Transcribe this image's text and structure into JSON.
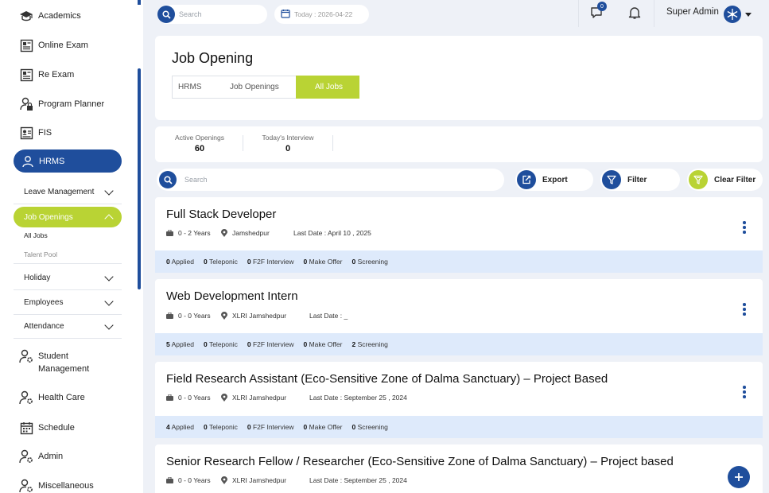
{
  "sidebar": {
    "items": [
      {
        "label": "Academics",
        "icon": "graduation-cap-icon"
      },
      {
        "label": "Online Exam",
        "icon": "exam-sheet-icon"
      },
      {
        "label": "Re Exam",
        "icon": "exam-sheet-icon"
      },
      {
        "label": "Program Planner",
        "icon": "user-lock-icon"
      },
      {
        "label": "FIS",
        "icon": "id-card-icon"
      },
      {
        "label": "HRMS",
        "icon": "user-icon"
      },
      {
        "label": "Student Management",
        "icon": "user-gear-icon"
      },
      {
        "label": "Health Care",
        "icon": "user-gear-icon"
      },
      {
        "label": "Schedule",
        "icon": "calendar-icon"
      },
      {
        "label": "Admin",
        "icon": "user-gear-icon"
      },
      {
        "label": "Miscellaneous",
        "icon": "user-gear-icon"
      }
    ],
    "hrms_sub": {
      "leave": "Leave Management",
      "job_openings": "Job Openings",
      "all_jobs": "All Jobs",
      "talent_pool": "Talent Pool",
      "holiday": "Holiday",
      "employees": "Employees",
      "attendance": "Attendance"
    }
  },
  "topbar": {
    "search_placeholder": "Search",
    "date": "Today : 2026-04-22",
    "message_count": "0",
    "user_name": "Super Admin"
  },
  "page": {
    "title": "Job Opening",
    "breadcrumb": [
      "HRMS",
      "Job Openings",
      "All Jobs"
    ]
  },
  "stats": {
    "active_label": "Active Openings",
    "active_value": "60",
    "interview_label": "Today's Interview",
    "interview_value": "0"
  },
  "toolbar": {
    "search_placeholder": "Search",
    "export": "Export",
    "filter": "Filter",
    "clear_filter": "Clear Filter"
  },
  "jobs": [
    {
      "title": "Full Stack Developer",
      "experience": "0 - 2 Years",
      "location": "Jamshedpur",
      "last_date": "Last Date : April 10 , 2025",
      "applied": "0",
      "telephonic": "0",
      "f2f": "0",
      "make_offer": "0",
      "screening": "0"
    },
    {
      "title": "Web Development Intern",
      "experience": "0 - 0 Years",
      "location": "XLRI Jamshedpur",
      "last_date": "Last Date : _",
      "applied": "5",
      "telephonic": "0",
      "f2f": "0",
      "make_offer": "0",
      "screening": "2"
    },
    {
      "title": "Field Research Assistant (Eco-Sensitive Zone of Dalma Sanctuary) – Project Based",
      "experience": "0 - 0 Years",
      "location": "XLRI Jamshedpur",
      "last_date": "Last Date : September 25 , 2024",
      "applied": "4",
      "telephonic": "0",
      "f2f": "0",
      "make_offer": "0",
      "screening": "0"
    },
    {
      "title": "Senior Research Fellow / Researcher (Eco-Sensitive Zone of Dalma Sanctuary) – Project based",
      "experience": "0 - 0 Years",
      "location": "XLRI Jamshedpur",
      "last_date": "Last Date : September 25 , 2024"
    }
  ],
  "labels": {
    "applied": "Applied",
    "telephonic": "Teleponic",
    "f2f": "F2F Interview",
    "make_offer": "Make Offer",
    "screening": "Screening"
  }
}
